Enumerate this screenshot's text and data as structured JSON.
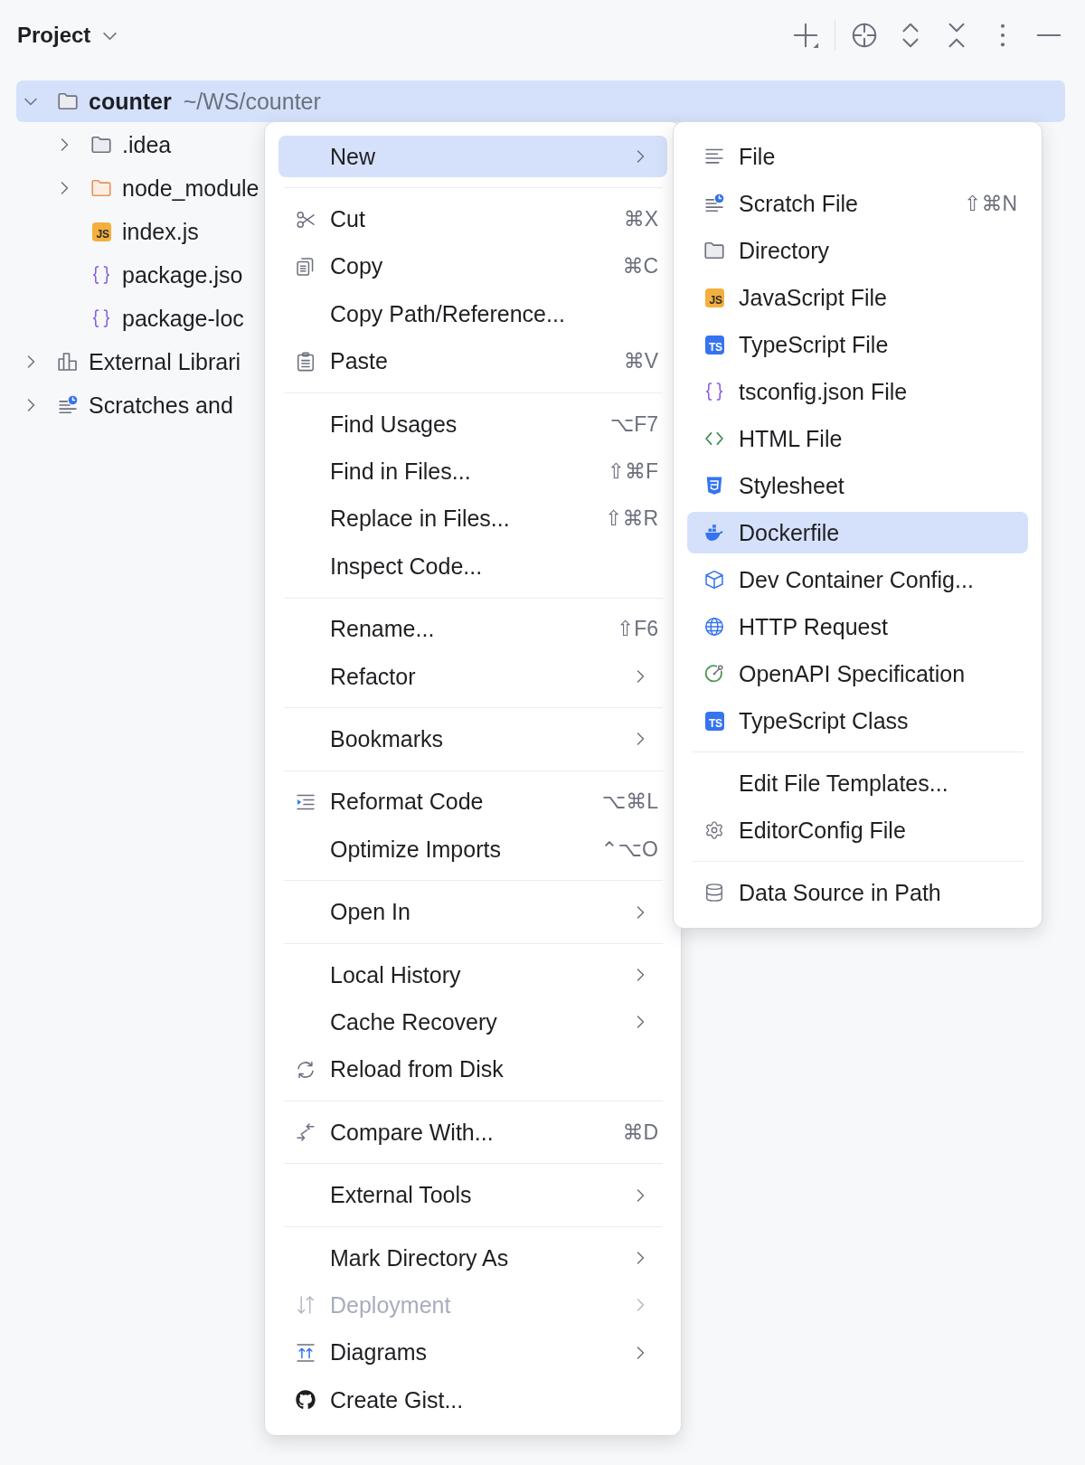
{
  "panel": {
    "title": "Project"
  },
  "tree": [
    {
      "name": "counter",
      "path": "~/WS/counter",
      "expanded": true,
      "selected": true,
      "children": [
        {
          "name": ".idea",
          "expanded": false,
          "selected": false
        },
        {
          "name": "node_module",
          "expanded": false,
          "selected": false
        },
        {
          "name": "index.js",
          "badge": {
            "text": "JS",
            "color": "#f4af3d"
          },
          "selected": false
        },
        {
          "name": "package.jso",
          "selected": false
        },
        {
          "name": "package-loc",
          "selected": false
        }
      ]
    },
    {
      "name": "External Librari",
      "expanded": false,
      "selected": false
    },
    {
      "name": "Scratches and",
      "expanded": false,
      "selected": false
    }
  ],
  "context_menu": {
    "groups": [
      [
        {
          "label": "New",
          "submenu": true,
          "selected": true,
          "disabled": false
        }
      ],
      [
        {
          "label": "Cut",
          "shortcut": "⌘X",
          "submenu": false,
          "selected": false,
          "disabled": false
        },
        {
          "label": "Copy",
          "shortcut": "⌘C",
          "submenu": false,
          "selected": false,
          "disabled": false
        },
        {
          "label": "Copy Path/Reference...",
          "submenu": false,
          "selected": false,
          "disabled": false
        },
        {
          "label": "Paste",
          "shortcut": "⌘V",
          "submenu": false,
          "selected": false,
          "disabled": false
        }
      ],
      [
        {
          "label": "Find Usages",
          "shortcut": "⌥F7",
          "submenu": false,
          "selected": false,
          "disabled": false
        },
        {
          "label": "Find in Files...",
          "shortcut": "⇧⌘F",
          "submenu": false,
          "selected": false,
          "disabled": false
        },
        {
          "label": "Replace in Files...",
          "shortcut": "⇧⌘R",
          "submenu": false,
          "selected": false,
          "disabled": false
        },
        {
          "label": "Inspect Code...",
          "submenu": false,
          "selected": false,
          "disabled": false
        }
      ],
      [
        {
          "label": "Rename...",
          "shortcut": "⇧F6",
          "submenu": false,
          "selected": false,
          "disabled": false
        },
        {
          "label": "Refactor",
          "submenu": true,
          "selected": false,
          "disabled": false
        }
      ],
      [
        {
          "label": "Bookmarks",
          "submenu": true,
          "selected": false,
          "disabled": false
        }
      ],
      [
        {
          "label": "Reformat Code",
          "shortcut": "⌥⌘L",
          "submenu": false,
          "selected": false,
          "disabled": false
        },
        {
          "label": "Optimize Imports",
          "shortcut": "⌃⌥O",
          "submenu": false,
          "selected": false,
          "disabled": false
        }
      ],
      [
        {
          "label": "Open In",
          "submenu": true,
          "selected": false,
          "disabled": false
        }
      ],
      [
        {
          "label": "Local History",
          "submenu": true,
          "selected": false,
          "disabled": false
        },
        {
          "label": "Cache Recovery",
          "submenu": true,
          "selected": false,
          "disabled": false
        },
        {
          "label": "Reload from Disk",
          "submenu": false,
          "selected": false,
          "disabled": false
        }
      ],
      [
        {
          "label": "Compare With...",
          "shortcut": "⌘D",
          "submenu": false,
          "selected": false,
          "disabled": false
        }
      ],
      [
        {
          "label": "External Tools",
          "submenu": true,
          "selected": false,
          "disabled": false
        }
      ],
      [
        {
          "label": "Mark Directory As",
          "submenu": true,
          "selected": false,
          "disabled": false
        },
        {
          "label": "Deployment",
          "submenu": true,
          "selected": false,
          "disabled": true
        },
        {
          "label": "Diagrams",
          "submenu": true,
          "selected": false,
          "disabled": false
        },
        {
          "label": "Create Gist...",
          "submenu": false,
          "selected": false,
          "disabled": false
        }
      ]
    ]
  },
  "submenu": {
    "groups": [
      [
        {
          "label": "File",
          "selected": false
        },
        {
          "label": "Scratch File",
          "shortcut": "⇧⌘N",
          "selected": false
        },
        {
          "label": "Directory",
          "selected": false
        },
        {
          "label": "JavaScript File",
          "badge": {
            "text": "JS",
            "color": "#f4af3d"
          },
          "selected": false
        },
        {
          "label": "TypeScript File",
          "badge": {
            "text": "TS",
            "color": "#3574f0"
          },
          "selected": false
        },
        {
          "label": "tsconfig.json File",
          "selected": false
        },
        {
          "label": "HTML File",
          "selected": false
        },
        {
          "label": "Stylesheet",
          "selected": false
        },
        {
          "label": "Dockerfile",
          "selected": true
        },
        {
          "label": "Dev Container Config...",
          "selected": false
        },
        {
          "label": "HTTP Request",
          "selected": false
        },
        {
          "label": "OpenAPI Specification",
          "selected": false
        },
        {
          "label": "TypeScript Class",
          "badge": {
            "text": "TS",
            "color": "#3574f0"
          },
          "selected": false
        }
      ],
      [
        {
          "label": "Edit File Templates...",
          "selected": false
        },
        {
          "label": "EditorConfig File",
          "selected": false
        }
      ],
      [
        {
          "label": "Data Source in Path",
          "selected": false
        }
      ]
    ]
  }
}
